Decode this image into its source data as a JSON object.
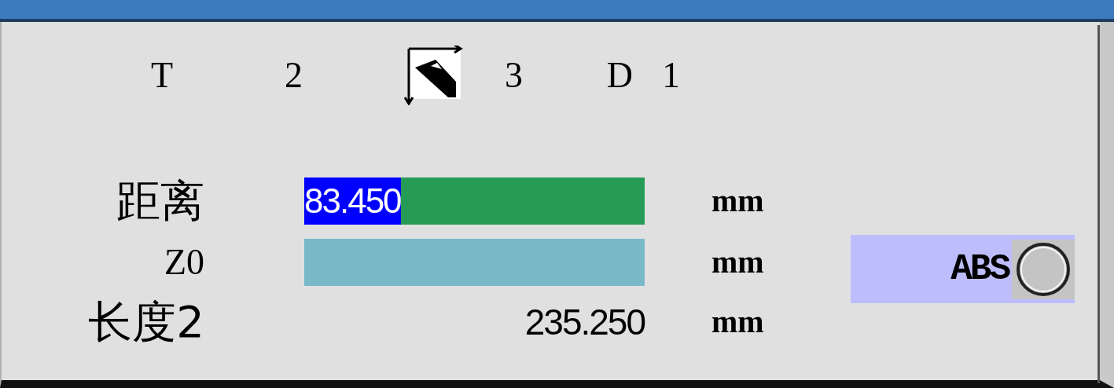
{
  "tool_header": {
    "items": [
      {
        "kind": "text",
        "label": "T"
      },
      {
        "kind": "text",
        "label": "2"
      },
      {
        "kind": "icon"
      },
      {
        "kind": "text",
        "label": "3"
      },
      {
        "kind": "text",
        "label": "D"
      },
      {
        "kind": "text",
        "label": "1"
      }
    ]
  },
  "rows": [
    {
      "label": "距离",
      "kind": "input",
      "value": "83.450",
      "value_highlighted": true,
      "color": "#259b55",
      "unit": "mm"
    },
    {
      "label": "Z0",
      "kind": "input",
      "color": "#78b9c8",
      "unit": "mm"
    },
    {
      "label": "长度2",
      "kind": "readout",
      "value": "235.250",
      "unit": "mm"
    }
  ],
  "abs_option": {
    "label": "ABS",
    "selected": false
  }
}
